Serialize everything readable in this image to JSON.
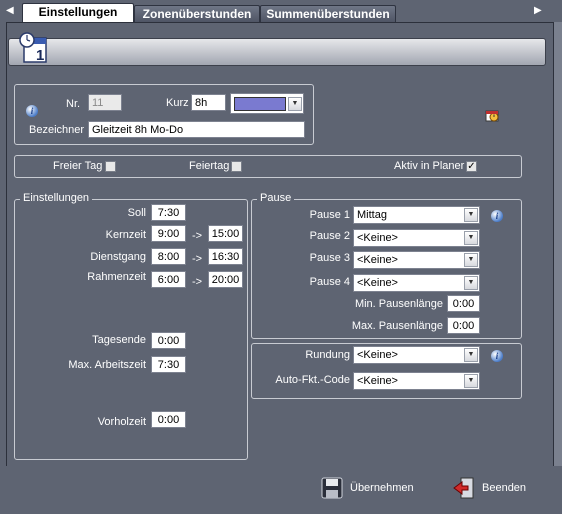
{
  "tabs": [
    {
      "label": "Einstellungen",
      "active": true
    },
    {
      "label": "Zonenüberstunden",
      "active": false
    },
    {
      "label": "Summenüberstunden",
      "active": false
    }
  ],
  "header": {
    "nr_label": "Nr.",
    "nr_value": "11",
    "kurz_label": "Kurz",
    "kurz_value": "8h",
    "color_value": "#7a7ad0",
    "bezeichner_label": "Bezeichner",
    "bezeichner_value": "Gleitzeit 8h Mo-Do"
  },
  "flags": {
    "freier_tag_label": "Freier Tag",
    "freier_tag_checked": false,
    "feiertag_label": "Feiertag",
    "feiertag_checked": false,
    "aktiv_label": "Aktiv in Planer",
    "aktiv_checked": true,
    "check_mark": "✓"
  },
  "einstellungen": {
    "legend": "Einstellungen",
    "soll_label": "Soll",
    "soll_value": "7:30",
    "kernzeit_label": "Kernzeit",
    "kernzeit_from": "9:00",
    "kernzeit_to": "15:00",
    "dienstgang_label": "Dienstgang",
    "dienstgang_from": "8:00",
    "dienstgang_to": "16:30",
    "rahmenzeit_label": "Rahmenzeit",
    "rahmenzeit_from": "6:00",
    "rahmenzeit_to": "20:00",
    "arrow": "->",
    "tagesende_label": "Tagesende",
    "tagesende_value": "0:00",
    "max_arbeitszeit_label": "Max. Arbeitszeit",
    "max_arbeitszeit_value": "7:30",
    "vorholzeit_label": "Vorholzeit",
    "vorholzeit_value": "0:00"
  },
  "pause": {
    "legend": "Pause",
    "pause1_label": "Pause 1",
    "pause1_value": "Mittag",
    "pause2_label": "Pause 2",
    "pause2_value": "<Keine>",
    "pause3_label": "Pause 3",
    "pause3_value": "<Keine>",
    "pause4_label": "Pause 4",
    "pause4_value": "<Keine>",
    "min_label": "Min. Pausenlänge",
    "min_value": "0:00",
    "max_label": "Max. Pausenlänge",
    "max_value": "0:00"
  },
  "rundung": {
    "rundung_label": "Rundung",
    "rundung_value": "<Keine>",
    "autofkt_label": "Auto-Fkt.-Code",
    "autofkt_value": "<Keine>"
  },
  "footer": {
    "save_label": "Übernehmen",
    "exit_label": "Beenden"
  },
  "icons": {
    "left_arrow": "◀",
    "right_arrow": "▶",
    "dropdown": "▼",
    "info": "i"
  }
}
